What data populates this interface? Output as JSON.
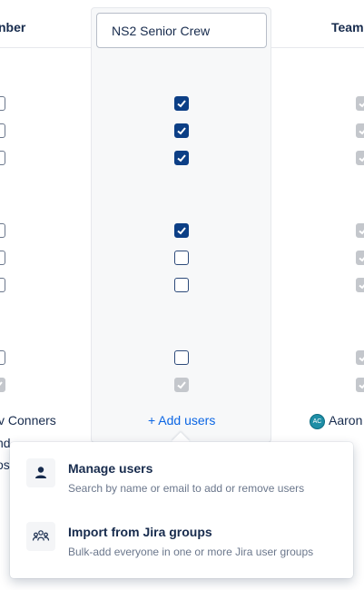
{
  "headers": {
    "left": "nber",
    "right": "Team"
  },
  "group": {
    "name_value": "NS2 Senior Crew",
    "checkboxes": [
      {
        "state": "checked"
      },
      {
        "state": "checked"
      },
      {
        "state": "checked"
      },
      {
        "state": "checked"
      },
      {
        "state": "unchecked"
      },
      {
        "state": "unchecked"
      },
      {
        "state": "unchecked"
      },
      {
        "state": "disabled-checked"
      }
    ],
    "add_users_label": "+ Add users"
  },
  "rows_left_text": {
    "name_line": "v Conners",
    "line2": "nd",
    "line3": "ost"
  },
  "rows_right_text": {
    "avatar_initials": "AC",
    "name_line": "Aaron"
  },
  "popup": {
    "items": [
      {
        "icon": "person-icon",
        "title": "Manage users",
        "description": "Search by name or email to add or remove users"
      },
      {
        "icon": "group-icon",
        "title": "Import from Jira groups",
        "description": "Bulk-add everyone in one or more Jira user groups"
      }
    ]
  },
  "colors": {
    "accent": "#0c3f86",
    "link": "#0c66e4",
    "disabled": "#c4c7cc"
  }
}
